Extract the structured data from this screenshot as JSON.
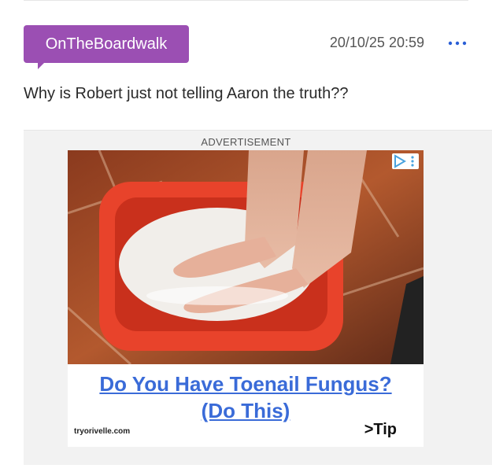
{
  "post": {
    "username": "OnTheBoardwalk",
    "timestamp": "20/10/25 20:59",
    "more_icon": "more-horizontal-icon",
    "body": "Why is Robert just not telling Aaron the truth??",
    "badge_color": "#9b4fb3"
  },
  "ad": {
    "label": "ADVERTISEMENT",
    "headline_line1": "Do You Have Toenail Fungus?",
    "headline_line2": "(Do This)",
    "domain": "tryorivelle.com",
    "cta": ">Tip",
    "adchoices_icon": "adchoices-icon",
    "headline_color": "#3a6bd8"
  }
}
